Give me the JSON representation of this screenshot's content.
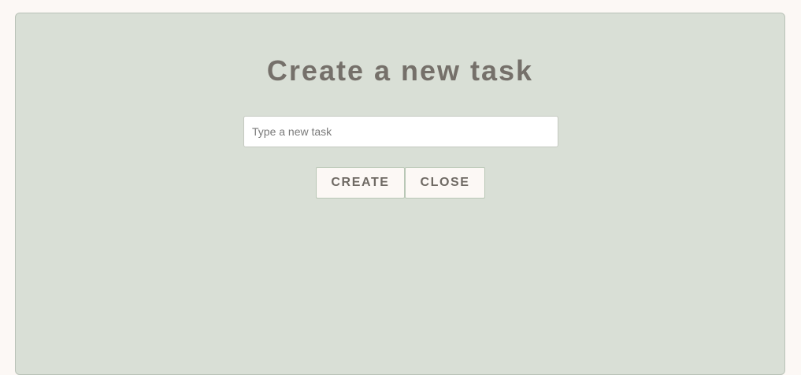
{
  "modal": {
    "title": "Create a new task",
    "input": {
      "placeholder": "Type a new task",
      "value": ""
    },
    "buttons": {
      "create_label": "CREATE",
      "close_label": "CLOSE"
    }
  },
  "colors": {
    "page_background": "#fcf8f5",
    "panel_background": "#d9dfd6",
    "title_text": "#75706a",
    "button_text": "#6f6a64",
    "button_background": "#fcf8f5"
  }
}
